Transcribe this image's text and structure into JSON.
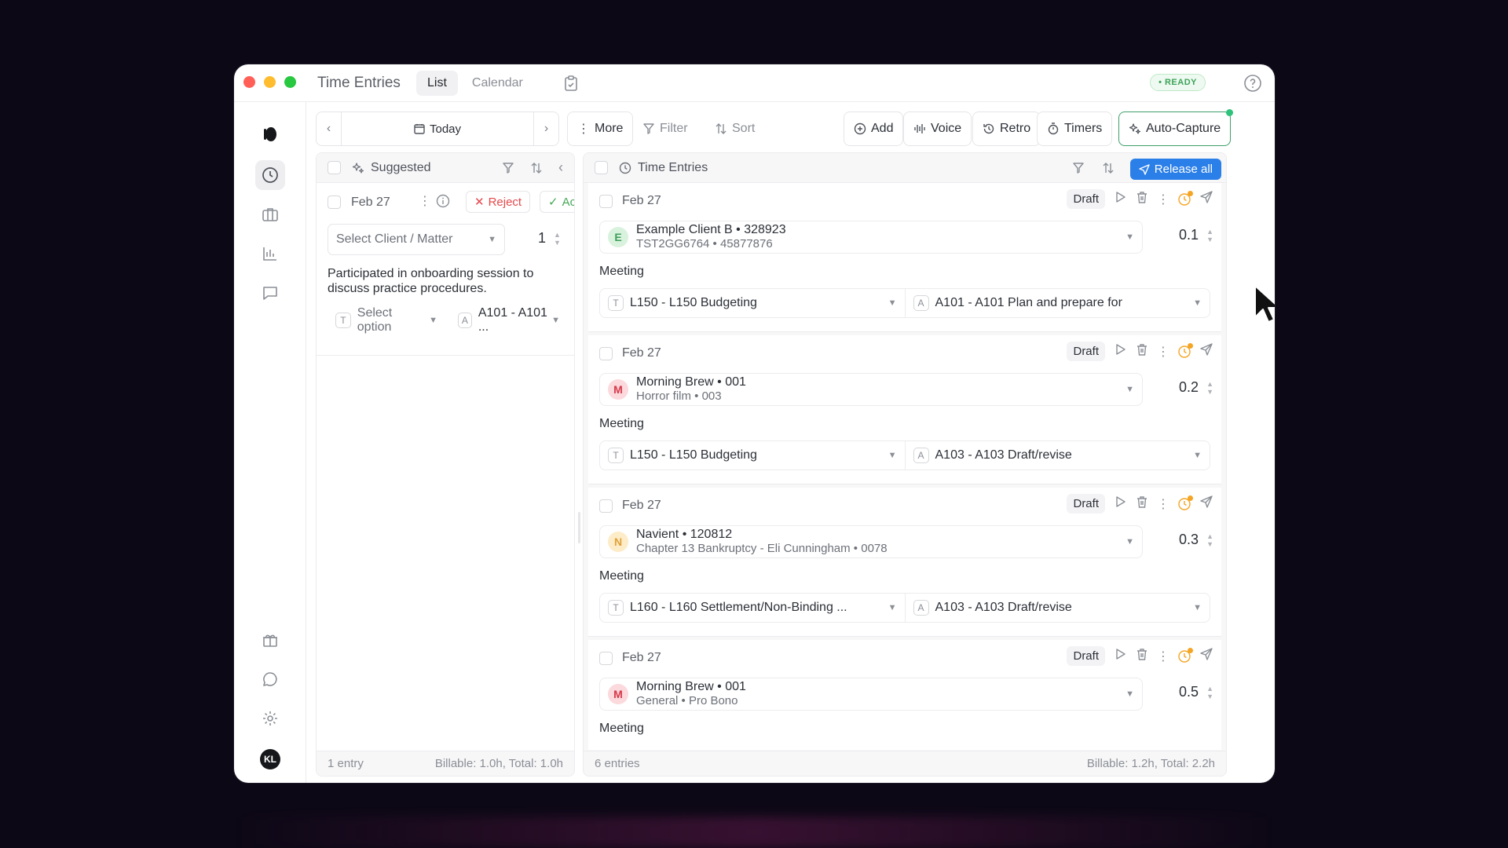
{
  "window": {
    "title": "Time Entries",
    "view_tabs": [
      "List",
      "Calendar"
    ],
    "status": "• READY"
  },
  "toolbar": {
    "today": "Today",
    "more": "More",
    "filter": "Filter",
    "sort": "Sort",
    "add": "Add",
    "voice": "Voice",
    "retro": "Retro",
    "timers": "Timers",
    "auto_capture": "Auto-Capture"
  },
  "suggested": {
    "title": "Suggested",
    "entry": {
      "date": "Feb 27",
      "reject": "Reject",
      "accept": "Accept",
      "client_placeholder": "Select Client / Matter",
      "hours": "1",
      "description": "Participated in onboarding session to discuss practice procedures.",
      "task_placeholder": "Select option",
      "task_letter": "T",
      "activity_letter": "A",
      "activity": "A101 - A101 ..."
    },
    "footer": {
      "count": "1 entry",
      "totals": "Billable: 1.0h, Total: 1.0h"
    }
  },
  "entries": {
    "title": "Time Entries",
    "release_all": "Release all",
    "items": [
      {
        "date": "Feb 27",
        "status": "Draft",
        "avatar": "E",
        "avatar_bg": "#d9f2dd",
        "avatar_fg": "#3f9f5a",
        "client": "Example Client B • 328923",
        "matter": "TST2GG6764 • 45877876",
        "hours": "0.1",
        "description": "Meeting",
        "task": "L150 - L150 Budgeting",
        "activity": "A101 - A101 Plan and prepare for"
      },
      {
        "date": "Feb 27",
        "status": "Draft",
        "avatar": "M",
        "avatar_bg": "#fbd9dc",
        "avatar_fg": "#d6384a",
        "client": "Morning Brew • 001",
        "matter": "Horror film • 003",
        "hours": "0.2",
        "description": "Meeting",
        "task": "L150 - L150 Budgeting",
        "activity": "A103 - A103 Draft/revise"
      },
      {
        "date": "Feb 27",
        "status": "Draft",
        "avatar": "N",
        "avatar_bg": "#fdecc8",
        "avatar_fg": "#e0a23a",
        "client": "Navient • 120812",
        "matter": "Chapter 13 Bankruptcy - Eli Cunningham • 0078",
        "hours": "0.3",
        "description": "Meeting",
        "task": "L160 - L160 Settlement/Non-Binding ...",
        "activity": "A103 - A103 Draft/revise"
      },
      {
        "date": "Feb 27",
        "status": "Draft",
        "avatar": "M",
        "avatar_bg": "#fbd9dc",
        "avatar_fg": "#d6384a",
        "client": "Morning Brew • 001",
        "matter": "General • Pro Bono",
        "hours": "0.5",
        "description": "Meeting"
      }
    ],
    "footer": {
      "count": "6 entries",
      "totals": "Billable: 1.2h, Total: 2.2h"
    }
  },
  "sidebar": {
    "user_initials": "KL"
  },
  "colors": {
    "accent": "#2b7fe8",
    "ready": "#3fa35a",
    "reject": "#e5484d",
    "accept": "#46a758"
  }
}
